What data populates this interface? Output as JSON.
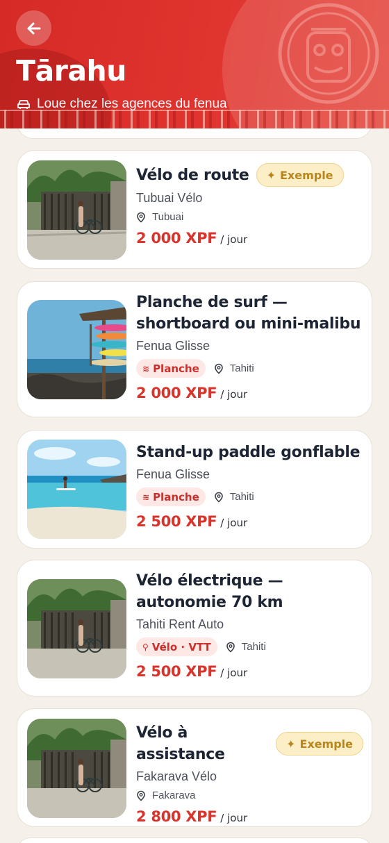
{
  "header": {
    "back_icon": "arrow-left-icon",
    "title": "Tārahu",
    "subtitle": "Loue chez les agences du fenua",
    "subtitle_icon": "car-icon",
    "brand_color": "#e0342f"
  },
  "listings": [
    {
      "name": "Vélo de route",
      "badge": "Exemple",
      "agency": "Tubuai Vélo",
      "category": "",
      "location": "Tubuai",
      "price": "2 000 XPF",
      "unit": "/ jour",
      "image": "bike-palms"
    },
    {
      "name": "Planche de surf — shortboard ou mini-malibu",
      "badge": "",
      "agency": "Fenua Glisse",
      "category": "Planche",
      "category_icon": "waves-icon",
      "location": "Tahiti",
      "price": "2 000 XPF",
      "unit": "/ jour",
      "image": "surfboards"
    },
    {
      "name": "Stand-up paddle gonflable",
      "badge": "",
      "agency": "Fenua Glisse",
      "category": "Planche",
      "category_icon": "waves-icon",
      "location": "Tahiti",
      "price": "2 500 XPF",
      "unit": "/ jour",
      "image": "paddle-lagoon"
    },
    {
      "name": "Vélo électrique — autonomie 70 km",
      "badge": "",
      "agency": "Tahiti Rent Auto",
      "category": "Vélo · VTT",
      "category_icon": "bike-icon",
      "location": "Tahiti",
      "price": "2 500 XPF",
      "unit": "/ jour",
      "image": "bike-palms"
    },
    {
      "name": "Vélo à assistance",
      "badge": "Exemple",
      "agency": "Fakarava Vélo",
      "category": "",
      "location": "Fakarava",
      "price": "2 800 XPF",
      "unit": "/ jour",
      "image": "bike-palms"
    }
  ],
  "colors": {
    "price": "#d9342c",
    "badge_bg": "#fcefc8",
    "category_bg": "#fde8e6",
    "page_bg": "#f5f1ea"
  }
}
